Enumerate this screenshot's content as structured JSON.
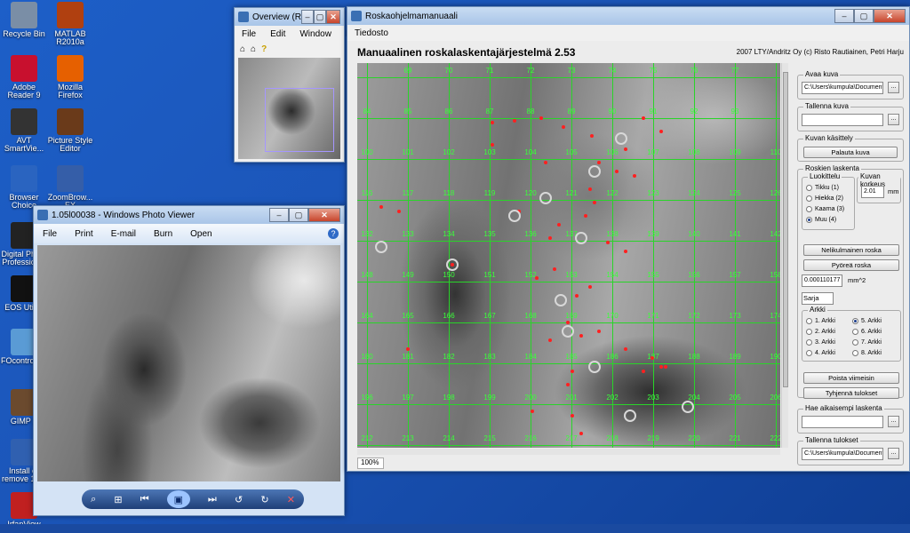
{
  "desktop_icons": [
    {
      "label": "Recycle Bin",
      "icon": "recycle-bin-icon"
    },
    {
      "label": "MATLAB R2010a",
      "icon": "matlab-icon"
    },
    {
      "label": "Adobe Reader 9",
      "icon": "adobe-reader-icon"
    },
    {
      "label": "Mozilla Firefox",
      "icon": "firefox-icon"
    },
    {
      "label": "AVT SmartVie...",
      "icon": "avt-smartview-icon"
    },
    {
      "label": "Picture Style Editor",
      "icon": "picture-style-editor-icon"
    },
    {
      "label": "Browser Choice",
      "icon": "browser-choice-icon"
    },
    {
      "label": "ZoomBrow... EX",
      "icon": "zoombrowser-icon"
    },
    {
      "label": "Digital Photo Professional",
      "icon": "digital-photo-professional-icon"
    },
    {
      "label": "EOS Utility",
      "icon": "eos-utility-icon"
    },
    {
      "label": "FOcontrol3...",
      "icon": "focontrol-icon"
    },
    {
      "label": "GIMP 2",
      "icon": "gimp-icon"
    },
    {
      "label": "Install or remove 13...",
      "icon": "install-remove-icon"
    },
    {
      "label": "IrfanView",
      "icon": "irfanview-icon"
    }
  ],
  "photo_viewer": {
    "title": "1.05l00038 - Windows Photo Viewer",
    "menu": [
      "File",
      "Print",
      "E-mail",
      "Burn",
      "Open"
    ]
  },
  "overview": {
    "title": "Overview (R...",
    "menu": [
      "File",
      "Edit",
      "Window",
      "Help"
    ]
  },
  "main": {
    "title": "Roskaohjelmamanuaali",
    "menu": [
      "Tiedosto"
    ],
    "heading": "Manuaalinen roskalaskentajärjestelmä 2.53",
    "credit": "2007 LTY/Andritz Oy (c) Risto Rautiainen, Petri Harju",
    "zoom": "100%",
    "grid_numbers": [
      [
        "69",
        "70",
        "71",
        "72",
        "73",
        "74",
        "75",
        "76",
        "77"
      ],
      [
        "84",
        "85",
        "86",
        "87",
        "88",
        "89",
        "90",
        "91",
        "92",
        "93"
      ],
      [
        "100",
        "101",
        "102",
        "103",
        "104",
        "105",
        "106",
        "107",
        "108",
        "109",
        "110"
      ],
      [
        "116",
        "117",
        "118",
        "119",
        "120",
        "121",
        "122",
        "123",
        "124",
        "125",
        "126"
      ],
      [
        "132",
        "133",
        "134",
        "135",
        "136",
        "137",
        "138",
        "139",
        "140",
        "141",
        "142"
      ],
      [
        "148",
        "149",
        "150",
        "151",
        "152",
        "153",
        "154",
        "155",
        "156",
        "157",
        "158"
      ],
      [
        "164",
        "165",
        "166",
        "167",
        "168",
        "169",
        "170",
        "171",
        "172",
        "173",
        "174"
      ],
      [
        "180",
        "181",
        "182",
        "183",
        "184",
        "185",
        "186",
        "187",
        "188",
        "189",
        "190"
      ],
      [
        "196",
        "197",
        "198",
        "199",
        "200",
        "201",
        "202",
        "203",
        "204",
        "205",
        "206"
      ],
      [
        "212",
        "213",
        "214",
        "215",
        "216",
        "217",
        "218",
        "219",
        "220",
        "221",
        "222"
      ]
    ],
    "panel": {
      "avaa_kuva_label": "Avaa kuva",
      "avaa_kuva_value": "C:\\Users\\kumpula\\Documents\\",
      "tallenna_kuva_label": "Tallenna kuva",
      "tallenna_kuva_value": "",
      "kuvan_kasittely_label": "Kuvan käsittely",
      "palauta_kuva": "Palauta kuva",
      "roskien_laskenta_label": "Roskien laskenta",
      "luokittelu_label": "Luokittelu",
      "luokittelu_options": [
        "Tikku (1)",
        "Hiekka (2)",
        "Kaarna (3)",
        "Muu (4)"
      ],
      "luokittelu_selected": 3,
      "kuvan_korkeus_label": "Kuvan korkeus",
      "kuvan_korkeus_value": "2.01",
      "kuvan_korkeus_unit": "mm",
      "nelikulmainen": "Nelikulmainen roska",
      "pyorea": "Pyöreä roska",
      "area_value": "0.000110177",
      "area_unit": "mm^2",
      "sarja_label": "Sarja",
      "sarja_value": "",
      "arkki_label": "Arkki",
      "arkki_options": [
        "1. Arkki",
        "5. Arkki",
        "2. Arkki",
        "6. Arkki",
        "3. Arkki",
        "7. Arkki",
        "4. Arkki",
        "8. Arkki"
      ],
      "arkki_selected": 1,
      "poista": "Poista viimeisin",
      "tyhjenna": "Tyhjennä tulokset",
      "hae_label": "Hae aikaisempi laskenta",
      "hae_value": "",
      "tallenna_tulokset_label": "Tallenna tulokset",
      "tallenna_tulokset_value": "C:\\Users\\kumpula\\Documents\\"
    }
  }
}
